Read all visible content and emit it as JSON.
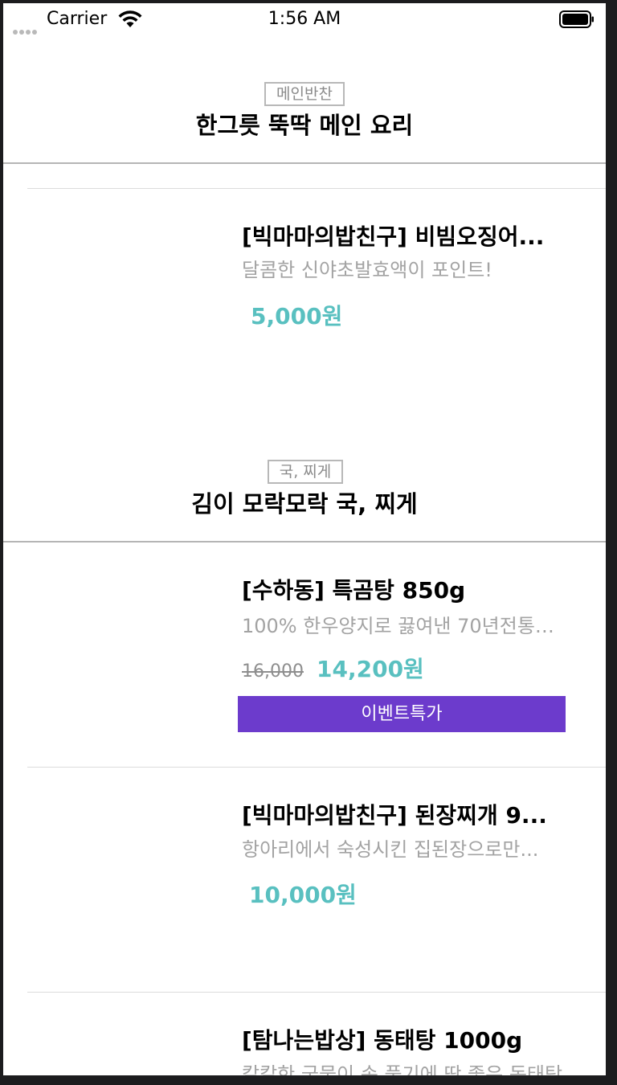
{
  "status_bar": {
    "carrier": "Carrier",
    "time": "1:56 AM",
    "icons": [
      "signal-dots-icon",
      "wifi-icon",
      "battery-icon"
    ]
  },
  "sections": [
    {
      "tag": "메인반찬",
      "title": "한그릇 뚝딱 메인 요리",
      "products": [
        {
          "title": "[빅마마의밥친구] 비빔오징어...",
          "description": "달콤한 신야초발효액이 포인트!",
          "original_price": "",
          "price": "5,000원",
          "badge": ""
        }
      ]
    },
    {
      "tag": "국, 찌게",
      "title": "김이 모락모락 국, 찌게",
      "products": [
        {
          "title": "[수하동] 특곰탕 850g",
          "description": "100% 한우양지로 끓여낸 70년전통…",
          "original_price": "16,000",
          "price": "14,200원",
          "badge": "이벤트특가"
        },
        {
          "title": "[빅마마의밥친구] 된장찌개 9...",
          "description": "항아리에서 숙성시킨 집된장으로만...",
          "original_price": "",
          "price": "10,000원",
          "badge": ""
        },
        {
          "title": "[탐나는밥상] 동태탕 1000g",
          "description": "칼칼한 국물이 속 풀기에 딱 좋은 동태탕",
          "original_price": "",
          "price": "",
          "badge": ""
        }
      ]
    }
  ],
  "colors": {
    "price": "#59c0c0",
    "badge_bg": "#6c3bcc",
    "muted_text": "#a3a3a3",
    "tag_border": "#b8b8b8"
  }
}
